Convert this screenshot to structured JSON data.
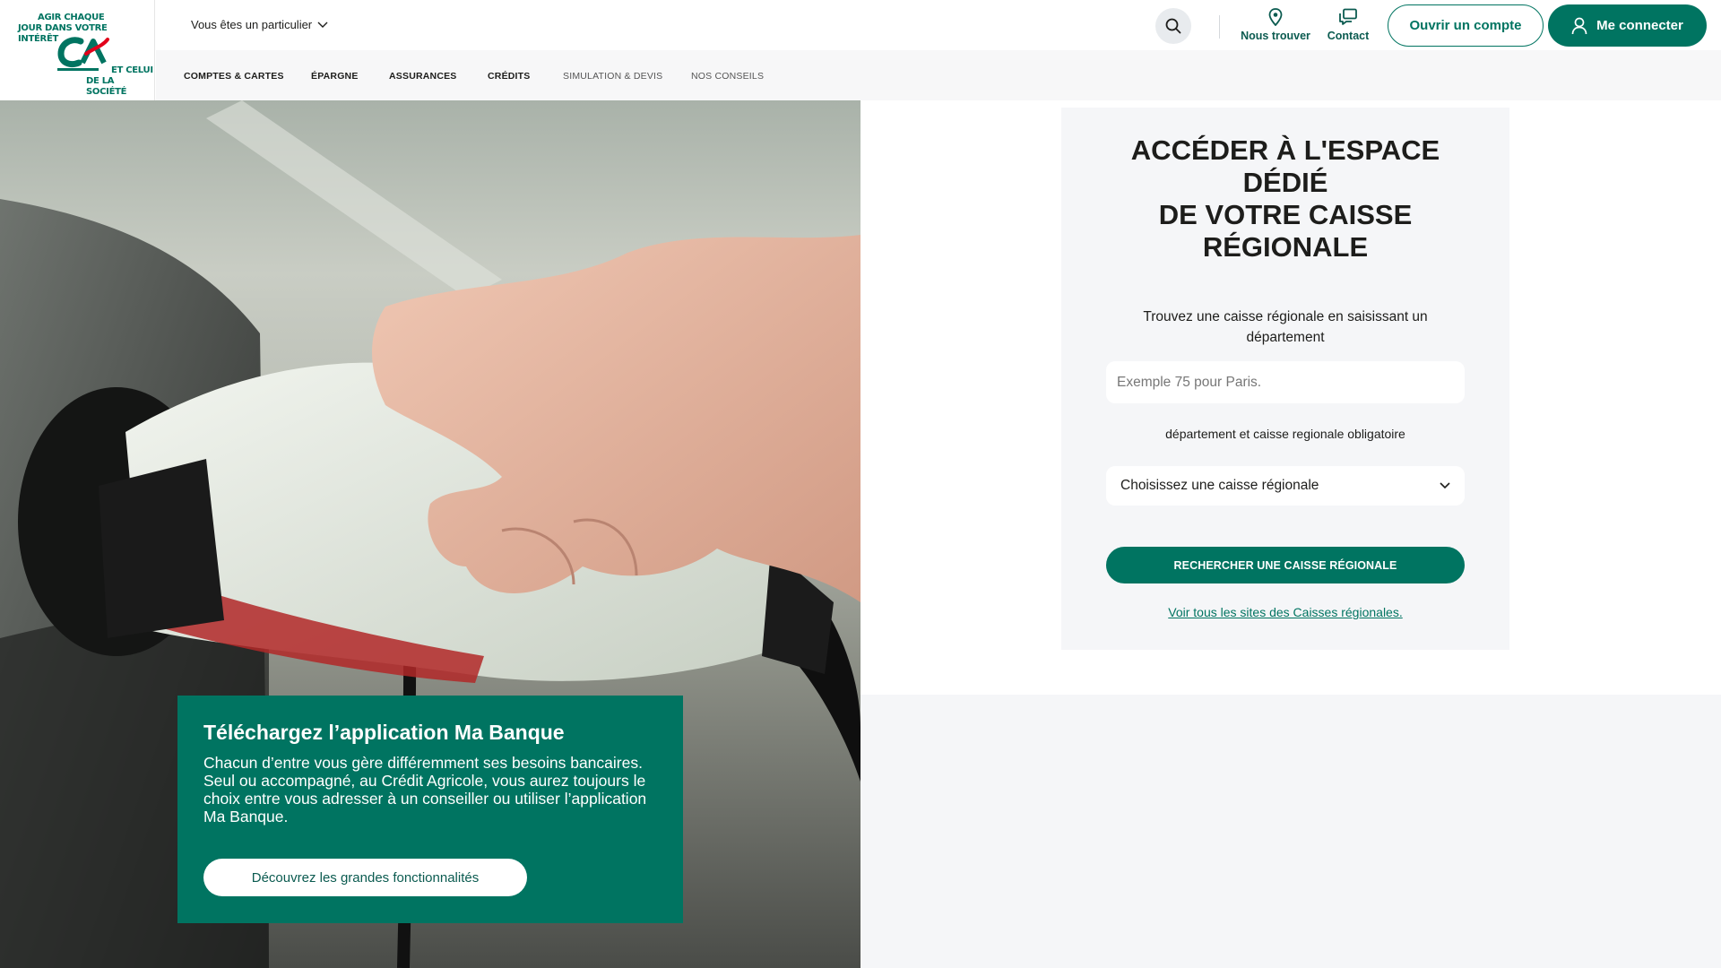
{
  "logo": {
    "line1": "AGIR CHAQUE",
    "line2": "JOUR DANS VOTRE",
    "line3": "INTÉRÊT",
    "line4": "ET CELUI",
    "line5": "DE LA SOCIÉTÉ"
  },
  "header": {
    "audience": "Vous êtes un particulier",
    "find_label": "Nous trouver",
    "contact_label": "Contact",
    "open_account": "Ouvrir un compte",
    "login": "Me connecter"
  },
  "nav": {
    "items": [
      "Comptes & cartes",
      "Épargne",
      "Assurances",
      "Crédits",
      "Simulation & devis",
      "Nos conseils"
    ]
  },
  "promo": {
    "title": "Téléchargez l’application Ma Banque",
    "text1": "Chacun d’entre vous gère différemment ses besoins bancaires.",
    "text2": "Seul ou accompagné, au Crédit Agricole, vous aurez toujours le choix entre vous adresser à un conseiller ou utiliser l’application Ma Banque.",
    "button": "Découvrez les grandes fonctionnalités"
  },
  "panel": {
    "title_line1": "Accéder à l'espace",
    "title_line2": "dédié",
    "title_line3": "de votre Caisse",
    "title_line4": "régionale",
    "subtitle": "Trouvez une caisse régionale en saisissant un département",
    "input_placeholder": "Exemple 75 pour Paris.",
    "required_note": "département et caisse regionale obligatoire",
    "select_value": "Choisissez une caisse régionale",
    "button": "Rechercher une caisse régionale",
    "link": "Voir tous les sites des Caisses régionales."
  },
  "colors": {
    "brand": "#007461",
    "panel_bg": "#f5f6f8"
  },
  "icons": [
    "chevron-down-icon",
    "search-icon",
    "location-pin-icon",
    "chat-icon",
    "user-icon"
  ]
}
